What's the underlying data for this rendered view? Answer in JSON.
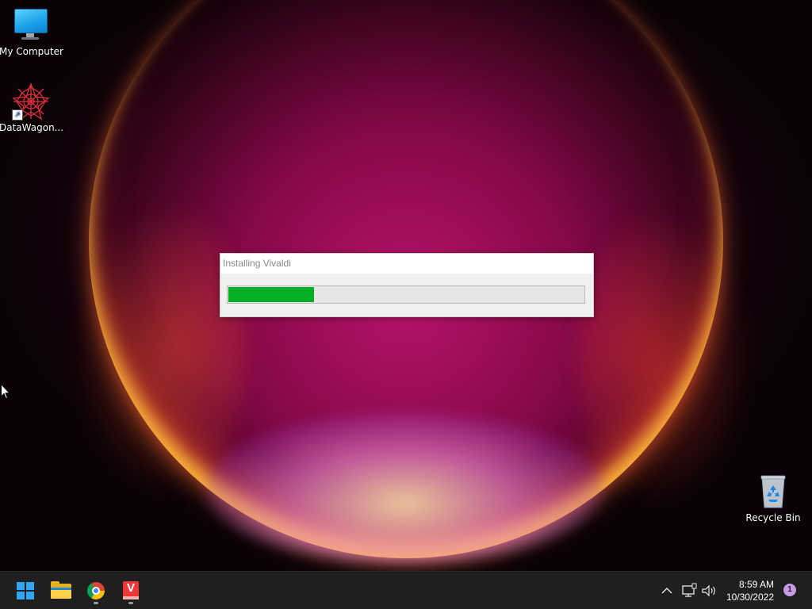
{
  "desktop": {
    "icons": [
      {
        "label": "My Computer",
        "icon": "computer-icon"
      },
      {
        "label": "DataWagon...",
        "icon": "datawagon-icon"
      },
      {
        "label": "Recycle Bin",
        "icon": "recycle-bin-icon"
      }
    ]
  },
  "dialog": {
    "title": "Installing Vivaldi",
    "progress_fraction": 0.24
  },
  "taskbar": {
    "apps": [
      {
        "name": "Start",
        "icon": "windows-start-icon"
      },
      {
        "name": "File Explorer",
        "icon": "file-explorer-icon"
      },
      {
        "name": "Google Chrome",
        "icon": "chrome-icon",
        "running": true
      },
      {
        "name": "Vivaldi Installer",
        "icon": "vivaldi-installer-icon",
        "running": true
      }
    ],
    "tray": {
      "icons": [
        "chevron-up-icon",
        "network-icon",
        "volume-icon"
      ],
      "time": "8:59 AM",
      "date": "10/30/2022",
      "notification_count": "1"
    }
  },
  "colors": {
    "progress_fill": "#06b025",
    "taskbar_bg": "#1f1f1f",
    "accent": "#2ea6f5"
  }
}
